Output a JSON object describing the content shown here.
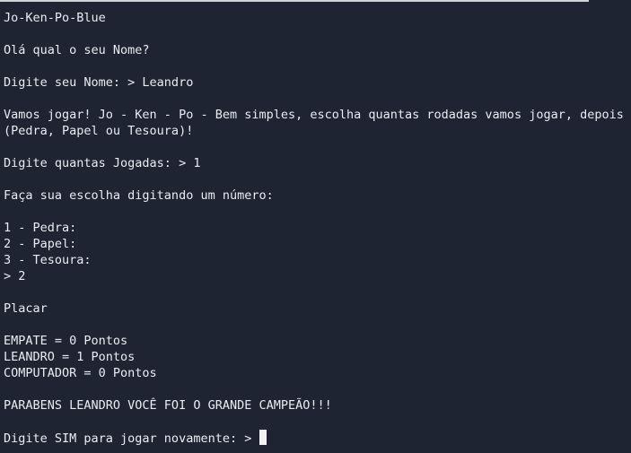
{
  "terminal": {
    "lines": [
      "Jo-Ken-Po-Blue",
      "",
      "Olá qual o seu Nome?",
      "",
      "Digite seu Nome: > Leandro",
      "",
      "Vamos jogar! Jo - Ken - Po - Bem simples, escolha quantas rodadas vamos jogar, depois",
      "(Pedra, Papel ou Tesoura)!",
      "",
      "Digite quantas Jogadas: > 1",
      "",
      "Faça sua escolha digitando um número:",
      "",
      "1 - Pedra:",
      "2 - Papel:",
      "3 - Tesoura:",
      "> 2",
      "",
      "Placar",
      "",
      "EMPATE = 0 Pontos",
      "LEANDRO = 1 Pontos",
      "COMPUTADOR = 0 Pontos",
      "",
      "PARABENS LEANDRO VOCÊ FOI O GRANDE CAMPEÃO!!!",
      "",
      "Digite SIM para jogar novamente: > "
    ]
  },
  "colors": {
    "background": "#1e2432",
    "foreground": "#e9ecf2",
    "cursor": "#f2f2f2"
  }
}
